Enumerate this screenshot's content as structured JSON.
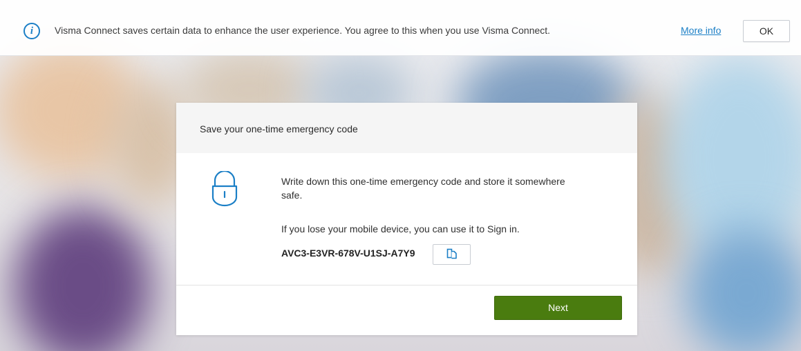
{
  "cookie_bar": {
    "icon": "info-icon",
    "icon_glyph": "i",
    "message": "Visma Connect saves certain data to enhance the user experience. You agree to this when you use Visma Connect.",
    "more_info_label": "More info",
    "ok_label": "OK"
  },
  "dialog": {
    "title": "Save your one-time emergency code",
    "icon": "lock-icon",
    "instruction": "Write down this one-time emergency code and store it somewhere safe.",
    "usage_note": "If you lose your mobile device, you can use it to Sign in.",
    "emergency_code": "AVC3-E3VR-678V-U1SJ-A7Y9",
    "copy_icon": "copy-icon",
    "next_label": "Next"
  },
  "colors": {
    "accent_blue": "#1b7fc6",
    "primary_green": "#4a7c0f",
    "header_gray": "#f5f5f5"
  }
}
